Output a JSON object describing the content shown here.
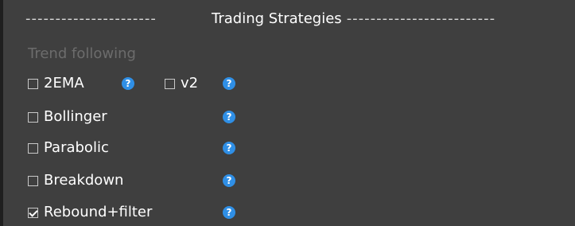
{
  "header": {
    "dashes_left": "----------------------",
    "title": "Trading Strategies",
    "dashes_right": "-------------------------"
  },
  "section": {
    "label": "Trend following"
  },
  "options": [
    {
      "label": "2EMA",
      "checked": false
    },
    {
      "label": "v2",
      "checked": false
    },
    {
      "label": "Bollinger",
      "checked": false
    },
    {
      "label": "Parabolic",
      "checked": false
    },
    {
      "label": "Breakdown",
      "checked": false
    },
    {
      "label": "Rebound+filter",
      "checked": true
    }
  ],
  "help_icon": {
    "glyph": "?",
    "icon": "question-circle-icon"
  },
  "colors": {
    "background": "#3f3f3f",
    "help_blue": "#2f8fe6",
    "disabled_text": "#6c6c6c"
  }
}
